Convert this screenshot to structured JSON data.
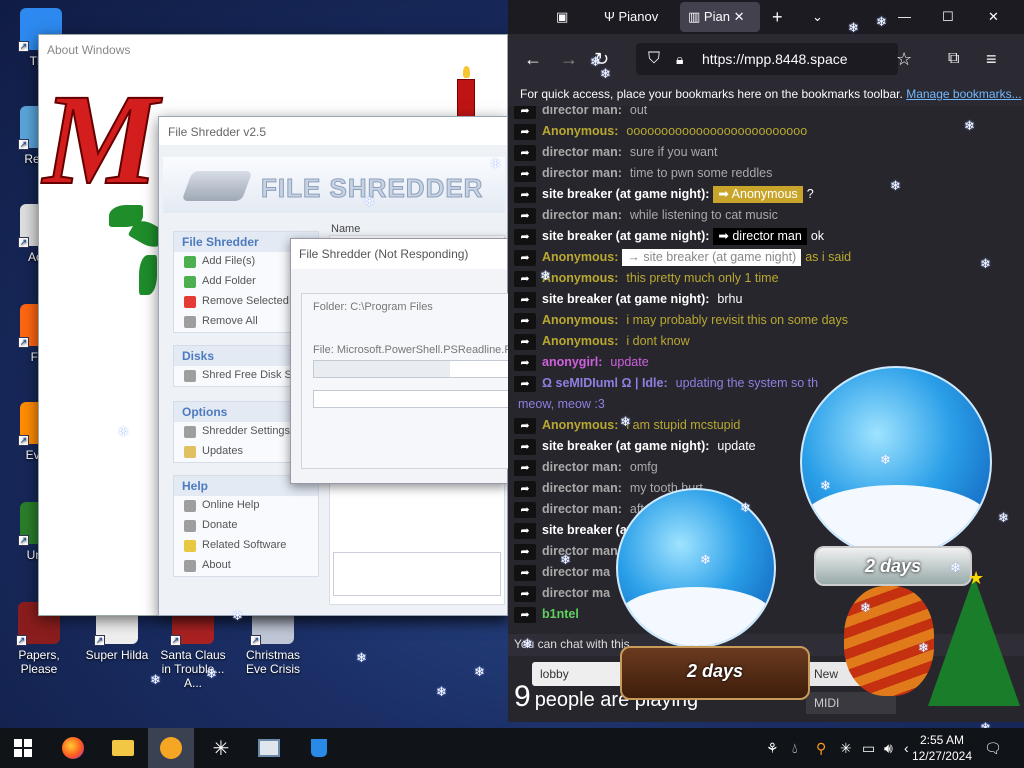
{
  "desktop": {
    "icons": [
      {
        "label": "This",
        "color": "#2d89ef"
      },
      {
        "label": "Recyc",
        "color": "#5aa3d9"
      },
      {
        "label": "Activ",
        "color": "#dddddd"
      },
      {
        "label": "Fire",
        "color": "#ff6611"
      },
      {
        "label": "Every",
        "color": "#ff8c00"
      },
      {
        "label": "Unde",
        "color": "#2a7d2a"
      },
      {
        "label": "Papers, Please",
        "color": "#8a1d1d"
      },
      {
        "label": "Super Hilda",
        "color": "#eeeeee"
      },
      {
        "label": "Santa Claus in Trouble... A...",
        "color": "#aa2222"
      },
      {
        "label": "Christmas Eve Crisis",
        "color": "#c0c8d8"
      }
    ]
  },
  "about_window": {
    "title": "About Windows"
  },
  "shredder": {
    "title": "File Shredder v2.5",
    "logo": "FILE SHREDDER",
    "name_col": "Name",
    "panels": [
      {
        "header": "File Shredder",
        "items": [
          {
            "label": "Add File(s)",
            "icon": "plus-icon",
            "color": "#4caf50"
          },
          {
            "label": "Add Folder",
            "icon": "plus-icon",
            "color": "#4caf50"
          },
          {
            "label": "Remove Selected",
            "icon": "minus-icon",
            "color": "#e53935"
          },
          {
            "label": "Remove All",
            "icon": "eraser-icon",
            "color": "#9e9e9e"
          }
        ]
      },
      {
        "header": "Disks",
        "items": [
          {
            "label": "Shred Free Disk Sp",
            "icon": "disk-icon",
            "color": "#9e9e9e"
          }
        ]
      },
      {
        "header": "Options",
        "items": [
          {
            "label": "Shredder Settings",
            "icon": "settings-icon",
            "color": "#9e9e9e"
          },
          {
            "label": "Updates",
            "icon": "updates-icon",
            "color": "#e0c060"
          }
        ]
      },
      {
        "header": "Help",
        "items": [
          {
            "label": "Online Help",
            "icon": "help-icon",
            "color": "#9e9e9e"
          },
          {
            "label": "Donate",
            "icon": "donate-icon",
            "color": "#9e9e9e"
          },
          {
            "label": "Related Software",
            "icon": "star-icon",
            "color": "#e8c840"
          },
          {
            "label": "About",
            "icon": "info-icon",
            "color": "#9e9e9e"
          }
        ]
      }
    ]
  },
  "not_responding": {
    "title": "File Shredder (Not Responding)",
    "folder": "Folder: C:\\Program Files",
    "file": "File: Microsoft.PowerShell.PSReadline.Re",
    "progress1": 0.7,
    "progress2": 0
  },
  "browser": {
    "tabs": [
      {
        "label": "Pianov",
        "active": false
      },
      {
        "label": "Pian",
        "active": true
      }
    ],
    "url": "https://mpp.8448.space",
    "bookmarks_text": "For quick access, place your bookmarks here on the bookmarks toolbar.",
    "bookmarks_link": "Manage bookmarks...",
    "chat": [
      {
        "who": "director man:",
        "msg": "out",
        "color": "#aaaaaa"
      },
      {
        "who": "Anonymous:",
        "msg": "oooooooooooooooooooooooooo",
        "color": "#b8a830"
      },
      {
        "who": "director man:",
        "msg": "sure if you want",
        "color": "#aaaaaa"
      },
      {
        "who": "director man:",
        "msg": "time to pwn some reddles",
        "color": "#aaaaaa"
      },
      {
        "who": "site breaker (at game night):",
        "msg": "?",
        "color": "#ffffff",
        "tag": "➡ Anonymous",
        "tagbg": "#c8a52a",
        "tagcolor": "#ffffff"
      },
      {
        "who": "director man:",
        "msg": "while listening to cat music",
        "color": "#aaaaaa"
      },
      {
        "who": "site breaker (at game night):",
        "msg": "ok",
        "color": "#ffffff",
        "tag": "➡ director man",
        "tagbg": "#000000",
        "tagcolor": "#ffffff"
      },
      {
        "who": "Anonymous:",
        "msg": "as i said",
        "color": "#b8a830",
        "tag": "→ site breaker (at game night)",
        "tagbg": "#ffffff",
        "tagcolor": "#888888"
      },
      {
        "who": "Anonymous:",
        "msg": "this pretty much only 1 time",
        "color": "#b8a830"
      },
      {
        "who": "site breaker (at game night):",
        "msg": "brhu",
        "color": "#ffffff"
      },
      {
        "who": "Anonymous:",
        "msg": "i may probably revisit this on some days",
        "color": "#b8a830"
      },
      {
        "who": "Anonymous:",
        "msg": "i dont know",
        "color": "#b8a830"
      },
      {
        "who": "anonygirl:",
        "msg": "update",
        "color": "#d060e0"
      },
      {
        "who": "Ω seMIDIuml Ω | Idle:",
        "msg": "updating the system so th",
        "color": "#8f7fe0"
      },
      {
        "who": "",
        "msg": "meow, meow :3",
        "color": "#8f7fe0"
      },
      {
        "who": "Anonymous:",
        "msg": "i am stupid mcstupid",
        "color": "#b8a830"
      },
      {
        "who": "site breaker (at game night):",
        "msg": "update",
        "color": "#ffffff"
      },
      {
        "who": "director man:",
        "msg": "omfg",
        "color": "#aaaaaa"
      },
      {
        "who": "director man:",
        "msg": "my tooth hurt",
        "color": "#aaaaaa"
      },
      {
        "who": "director man:",
        "msg": "afte",
        "color": "#aaaaaa"
      },
      {
        "who": "site breaker (at",
        "msg": "",
        "color": "#ffffff"
      },
      {
        "who": "director man",
        "msg": "",
        "color": "#aaaaaa"
      },
      {
        "who": "director ma",
        "msg": "",
        "color": "#aaaaaa"
      },
      {
        "who": "director ma",
        "msg": "",
        "color": "#aaaaaa"
      },
      {
        "who": "b1ntel",
        "msg": "",
        "color": "#60d060"
      }
    ],
    "chat_notice": "You can chat with this",
    "lobby": "lobby",
    "new_room": "New",
    "midi": "MIDI",
    "player_count": "9",
    "players_text": "people are playing",
    "globe_label_left": "2 days",
    "globe_label_right": "2 days"
  },
  "taskbar": {
    "time": "2:55 AM",
    "date": "12/27/2024"
  }
}
